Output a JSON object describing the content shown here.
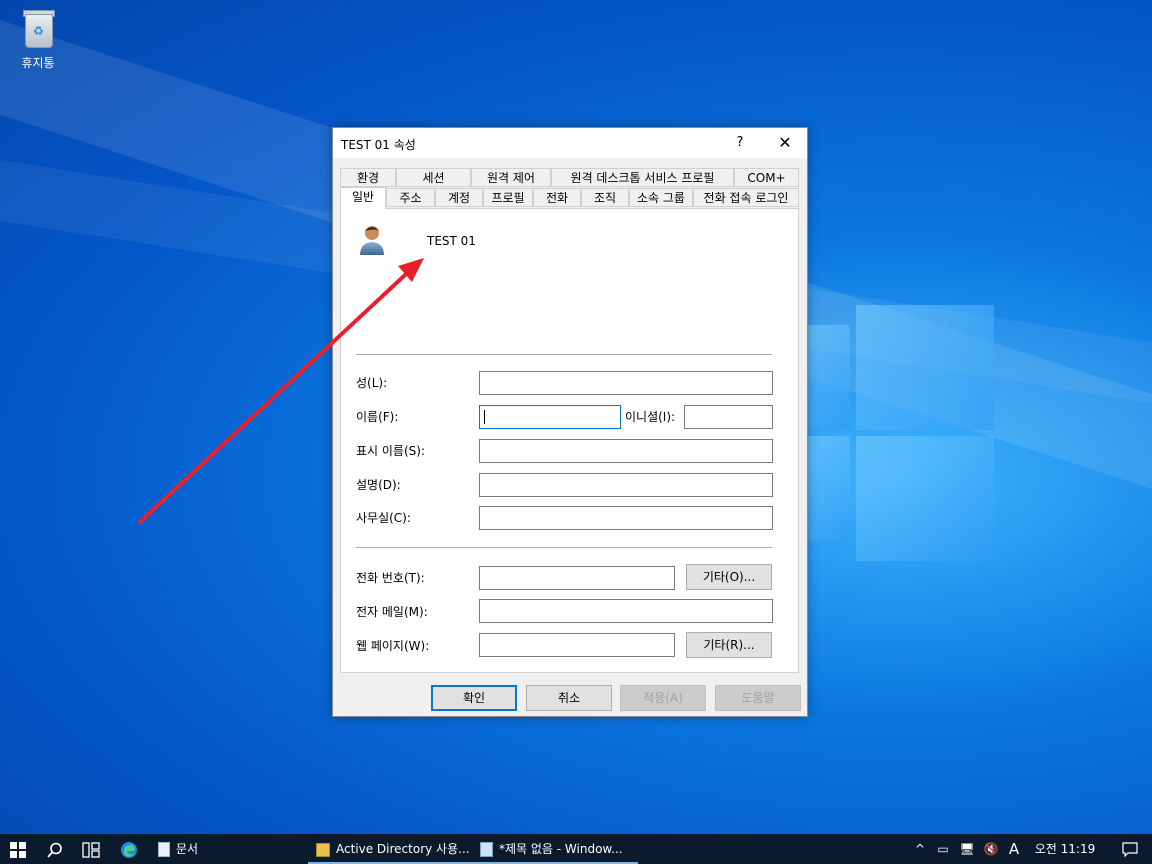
{
  "desktop": {
    "recycle_bin_label": "휴지통"
  },
  "dialog": {
    "title": "TEST 01 속성",
    "help_glyph": "?",
    "close_glyph": "✕",
    "tabs_row1": [
      "환경",
      "세션",
      "원격 제어",
      "원격 데스크톱 서비스 프로필",
      "COM+"
    ],
    "tabs_row2": [
      "일반",
      "주소",
      "계정",
      "프로필",
      "전화",
      "조직",
      "소속 그룹",
      "전화 접속 로그인"
    ],
    "active_tab": "일반",
    "user_display": "TEST 01",
    "fields": {
      "last_name_label": "성(L):",
      "first_name_label": "이름(F):",
      "initials_label": "이니셜(I):",
      "display_name_label": "표시 이름(S):",
      "description_label": "설명(D):",
      "office_label": "사무실(C):",
      "phone_label": "전화 번호(T):",
      "email_label": "전자 메일(M):",
      "webpage_label": "웹 페이지(W):"
    },
    "other_phone_button": "기타(O)...",
    "other_web_button": "기타(R)...",
    "ok_button": "확인",
    "cancel_button": "취소",
    "apply_button": "적용(A)",
    "help_button": "도움말"
  },
  "taskbar": {
    "docs": "문서",
    "app1": "Active Directory 사용...",
    "app2": "*제목 없음 - Window...",
    "ime": "A",
    "clock": "오전 11:19"
  },
  "colors": {
    "accent": "#0078d7",
    "arrow": "#e8202a",
    "taskbar": "#0b1a2c"
  }
}
